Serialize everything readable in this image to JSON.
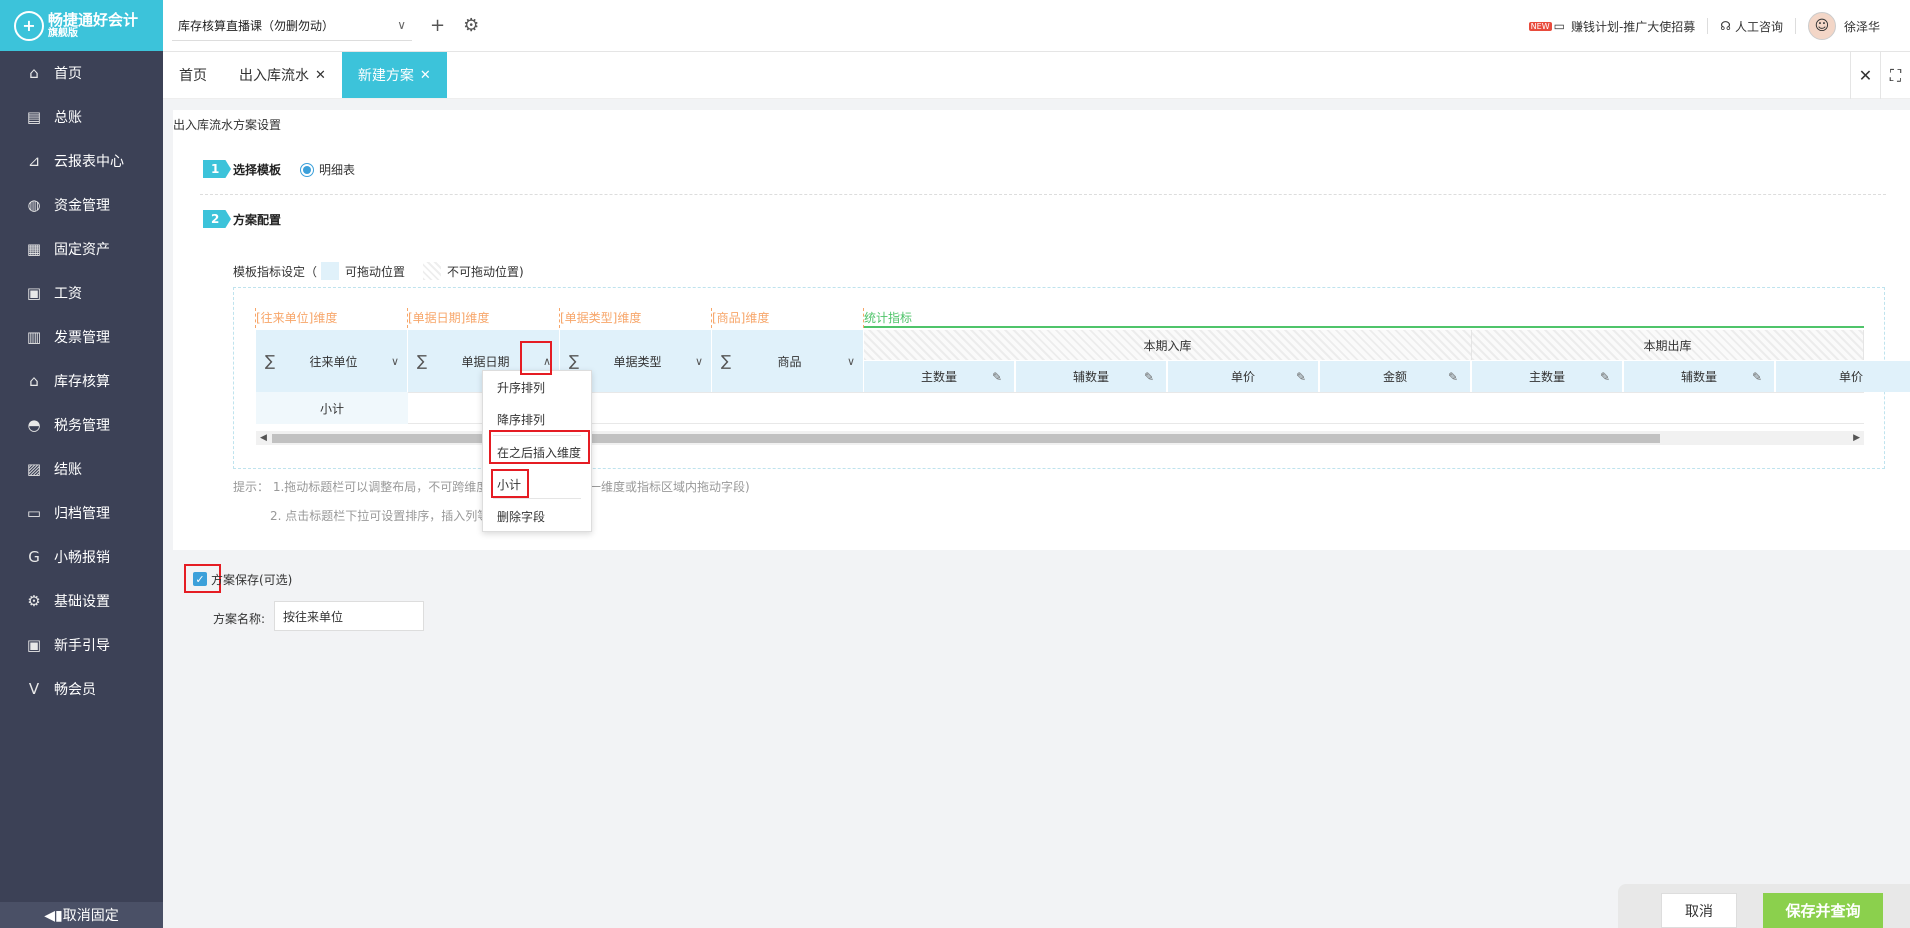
{
  "app": {
    "logo_title": "畅捷通好会计",
    "logo_sub": "旗舰版",
    "logo_glyph": "+"
  },
  "sidebar": {
    "items": [
      {
        "label": "首页",
        "icon": "⌂"
      },
      {
        "label": "总账",
        "icon": "▤"
      },
      {
        "label": "云报表中心",
        "icon": "⊿"
      },
      {
        "label": "资金管理",
        "icon": "◍"
      },
      {
        "label": "固定资产",
        "icon": "▦"
      },
      {
        "label": "工资",
        "icon": "▣"
      },
      {
        "label": "发票管理",
        "icon": "▥"
      },
      {
        "label": "库存核算",
        "icon": "⌂"
      },
      {
        "label": "税务管理",
        "icon": "◓"
      },
      {
        "label": "结账",
        "icon": "▨"
      },
      {
        "label": "归档管理",
        "icon": "▭"
      },
      {
        "label": "小畅报销",
        "icon": "G"
      },
      {
        "label": "基础设置",
        "icon": "⚙"
      },
      {
        "label": "新手引导",
        "icon": "▣"
      },
      {
        "label": "畅会员",
        "icon": "V"
      }
    ],
    "unpin_label": "◀▮取消固定"
  },
  "topbar": {
    "book": "库存核算直播课（勿删勿动）",
    "promo_badge": "NEW",
    "promo": "赚钱计划-推广大使招募",
    "support": "人工咨询",
    "user": "徐泽华"
  },
  "tabs": [
    {
      "label": "首页",
      "closable": false,
      "active": false
    },
    {
      "label": "出入库流水",
      "closable": true,
      "active": false
    },
    {
      "label": "新建方案",
      "closable": true,
      "active": true
    }
  ],
  "page": {
    "section_title": "出入库流水方案设置",
    "step1": {
      "num": "1",
      "label": "选择模板",
      "option": "明细表"
    },
    "step2": {
      "num": "2",
      "label": "方案配置"
    },
    "legend": {
      "prefix": "模板指标设定（",
      "drag": "可拖动位置",
      "nodrag": "不可拖动位置)"
    },
    "dim_labels": [
      "[往来单位]维度",
      "[单据日期]维度",
      "[单据类型]维度",
      "[商品]维度"
    ],
    "stat_label": "统计指标",
    "dimensions": [
      "往来单位",
      "单据日期",
      "单据类型",
      "商品"
    ],
    "groups": [
      "本期入库",
      "本期出库"
    ],
    "metrics": [
      "主数量",
      "辅数量",
      "单价",
      "金额",
      "主数量",
      "辅数量",
      "单价"
    ],
    "subtotal": "小计",
    "hint1": "提示：  1.拖动标题栏可以调整布局，不可跨维度拖动字段(只能在同一维度或指标区域内拖动字段)",
    "hint2": "2. 点击标题栏下拉可设置排序，插入列等"
  },
  "dropdown": [
    "升序排列",
    "降序排列",
    "在之后插入维度",
    "小计",
    "删除字段"
  ],
  "save": {
    "checkbox_label": "方案保存(可选)",
    "name_label": "方案名称:",
    "name_value": "按往来单位"
  },
  "footer": {
    "cancel": "取消",
    "save_query": "保存并查询"
  }
}
